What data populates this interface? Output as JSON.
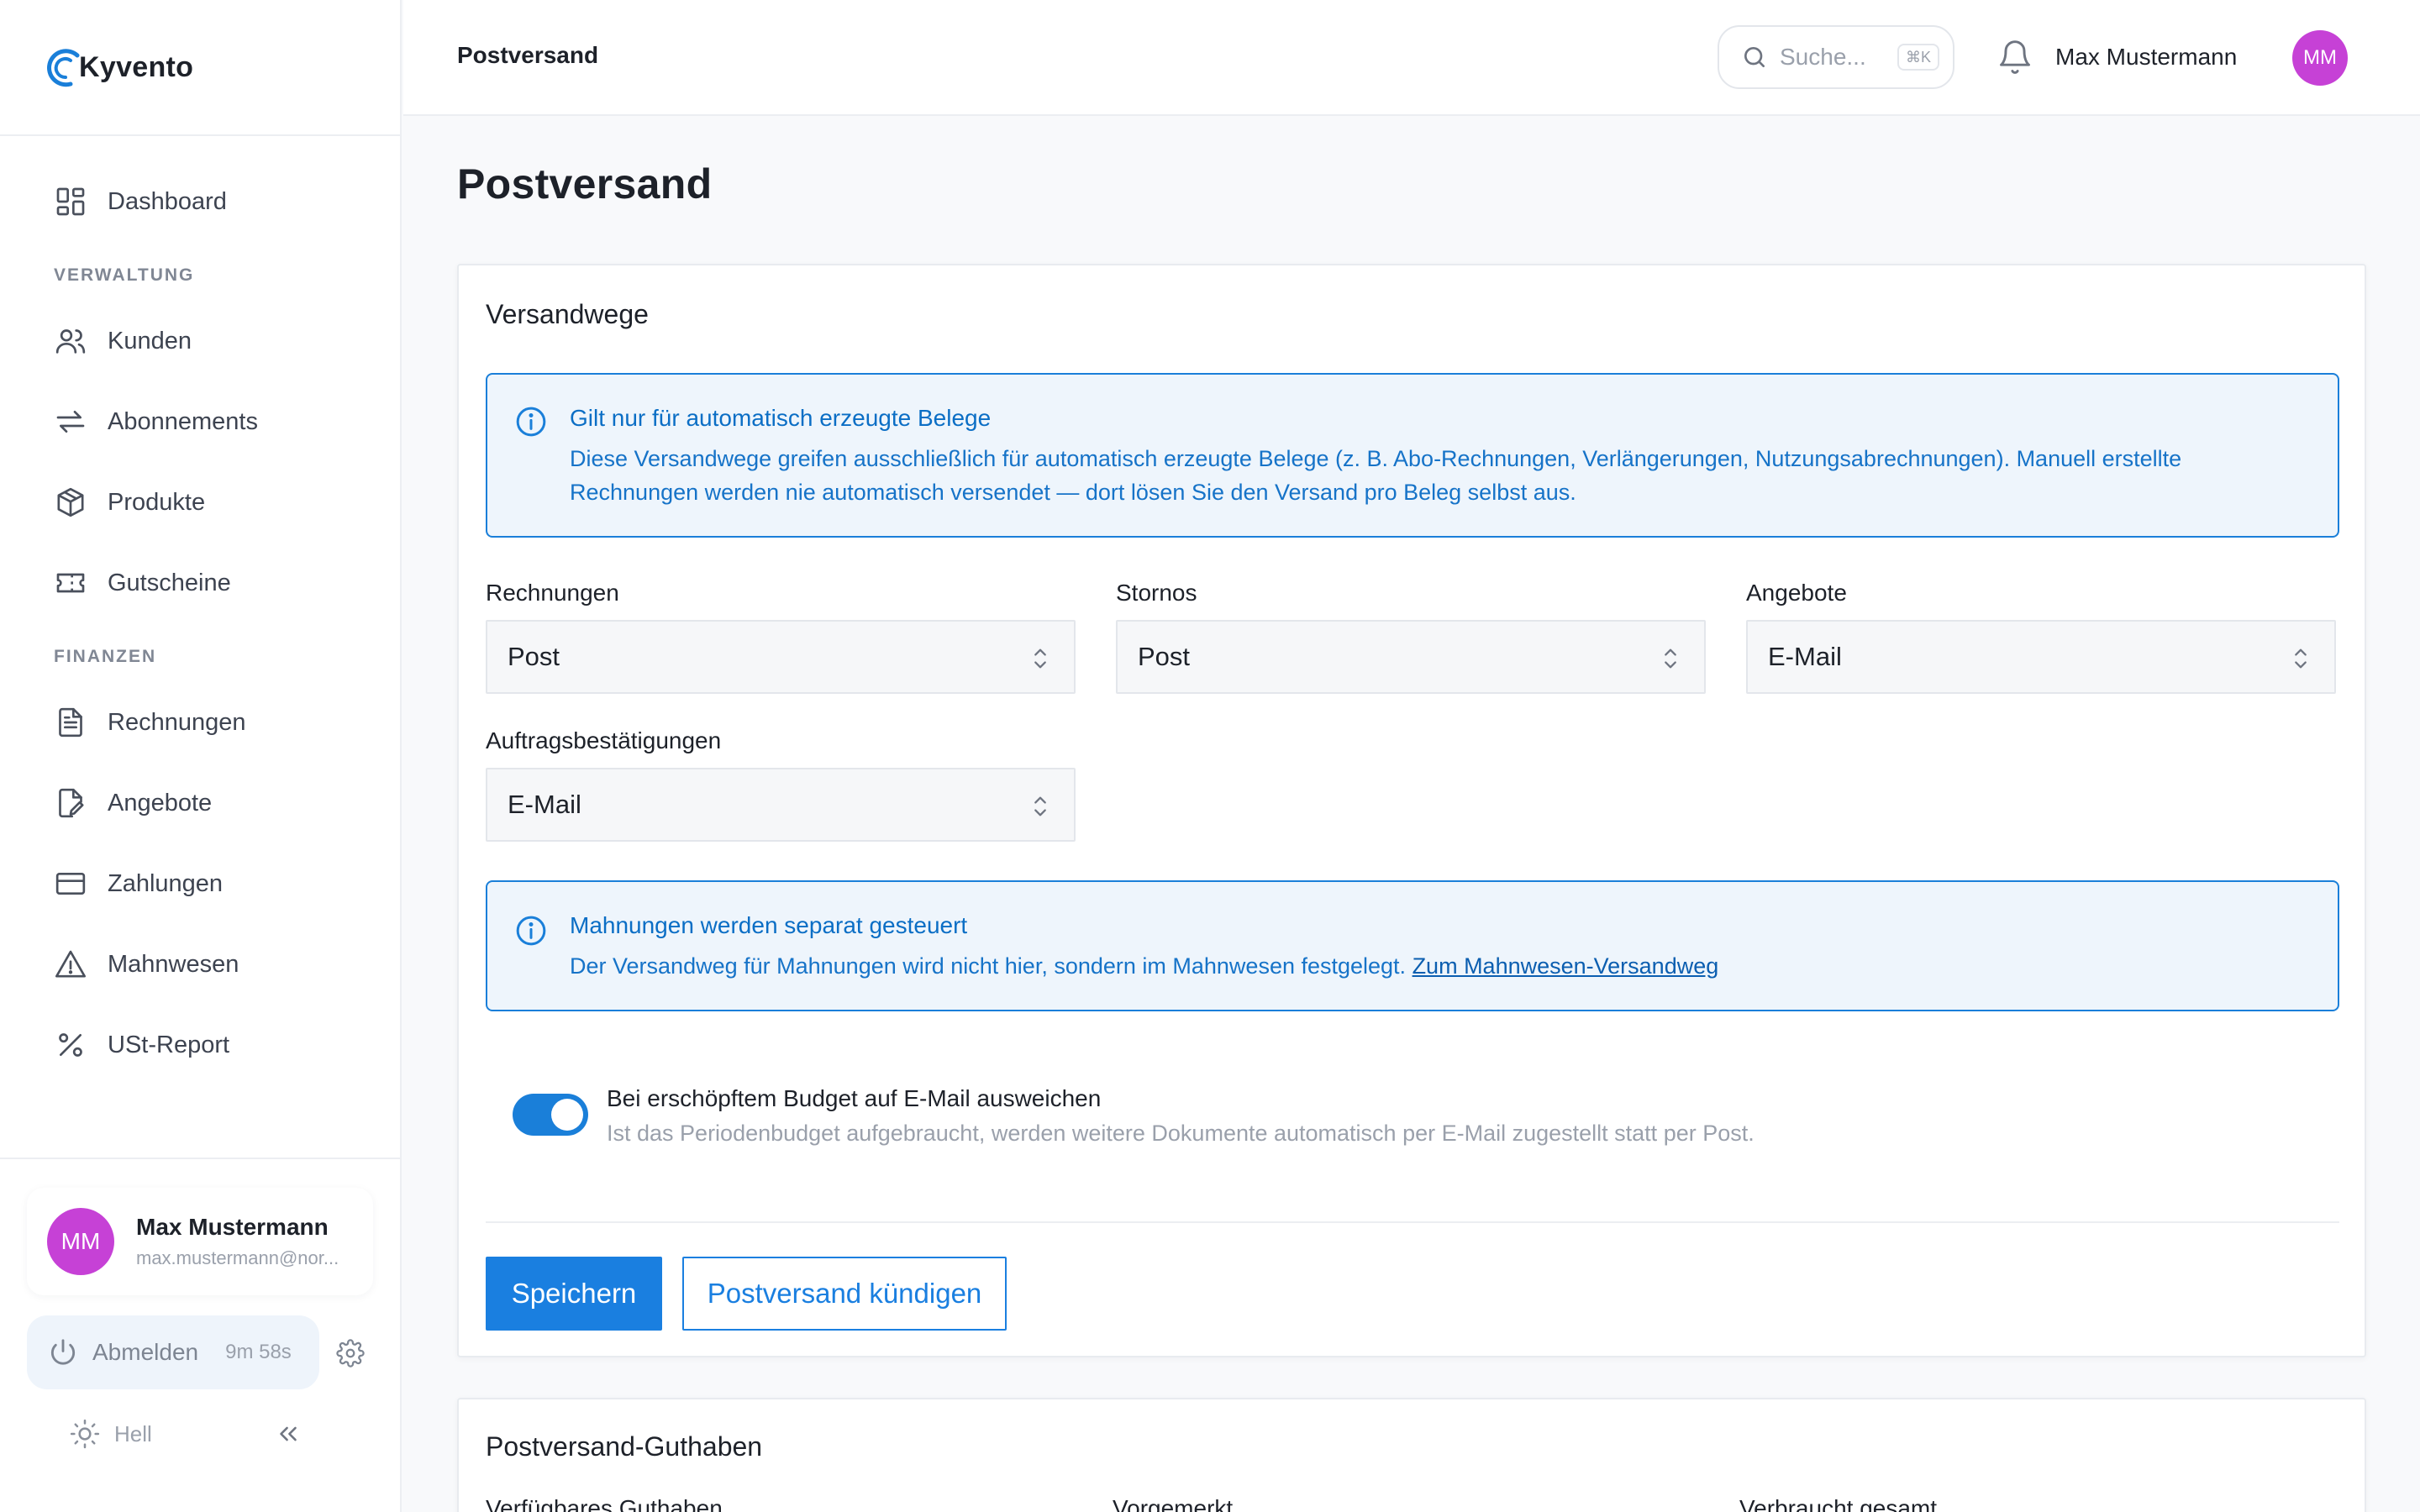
{
  "app": {
    "name": "Kyvento"
  },
  "sidebar": {
    "items_top": [
      {
        "label": "Dashboard",
        "icon": "dashboard-icon"
      }
    ],
    "section_verwaltung": "VERWALTUNG",
    "items_verwaltung": [
      {
        "label": "Kunden",
        "icon": "users-icon"
      },
      {
        "label": "Abonnements",
        "icon": "repeat-icon"
      },
      {
        "label": "Produkte",
        "icon": "package-icon"
      },
      {
        "label": "Gutscheine",
        "icon": "ticket-icon"
      }
    ],
    "section_finanzen": "FINANZEN",
    "items_finanzen": [
      {
        "label": "Rechnungen",
        "icon": "file-text-icon"
      },
      {
        "label": "Angebote",
        "icon": "file-edit-icon"
      },
      {
        "label": "Zahlungen",
        "icon": "credit-card-icon"
      },
      {
        "label": "Mahnwesen",
        "icon": "warning-icon"
      },
      {
        "label": "USt-Report",
        "icon": "percent-icon"
      }
    ],
    "user": {
      "initials": "MM",
      "name": "Max Mustermann",
      "email": "max.mustermann@nor..."
    },
    "logout": {
      "label": "Abmelden",
      "timer": "9m 58s"
    },
    "theme": {
      "label": "Hell"
    }
  },
  "topbar": {
    "title": "Postversand",
    "search_placeholder": "Suche...",
    "search_shortcut": "⌘K",
    "user_name": "Max Mustermann",
    "user_initials": "MM"
  },
  "page": {
    "title": "Postversand",
    "versandwege": {
      "title": "Versandwege",
      "info_auto": {
        "title": "Gilt nur für automatisch erzeugte Belege",
        "line1": "Diese Versandwege greifen ausschließlich für automatisch erzeugte Belege (z. B. Abo-Rechnungen, Verlängerungen, Nutzungsabrechnungen). Manuell erstellte",
        "line2": "Rechnungen werden nie automatisch versendet — dort lösen Sie den Versand pro Beleg selbst aus."
      },
      "fields": {
        "rechnungen": {
          "label": "Rechnungen",
          "value": "Post"
        },
        "stornos": {
          "label": "Stornos",
          "value": "Post"
        },
        "angebote": {
          "label": "Angebote",
          "value": "E-Mail"
        },
        "auftrag": {
          "label": "Auftragsbestätigungen",
          "value": "E-Mail"
        }
      },
      "info_mahnung": {
        "title": "Mahnungen werden separat gesteuert",
        "text": "Der Versandweg für Mahnungen wird nicht hier, sondern im Mahnwesen festgelegt. ",
        "link": "Zum Mahnwesen-Versandweg"
      },
      "toggle": {
        "on": true,
        "title": "Bei erschöpftem Budget auf E-Mail ausweichen",
        "description": "Ist das Periodenbudget aufgebraucht, werden weitere Dokumente automatisch per E-Mail zugestellt statt per Post."
      },
      "save_label": "Speichern",
      "cancel_label": "Postversand kündigen"
    },
    "guthaben": {
      "title": "Postversand-Guthaben",
      "labels": [
        "Verfügbares Guthaben",
        "Vorgemerkt",
        "Verbraucht gesamt"
      ]
    }
  },
  "colors": {
    "accent": "#1a7fe0",
    "avatar": "#c641d6",
    "info_bg": "#eef5fc",
    "info_border": "#1a7fd9"
  }
}
